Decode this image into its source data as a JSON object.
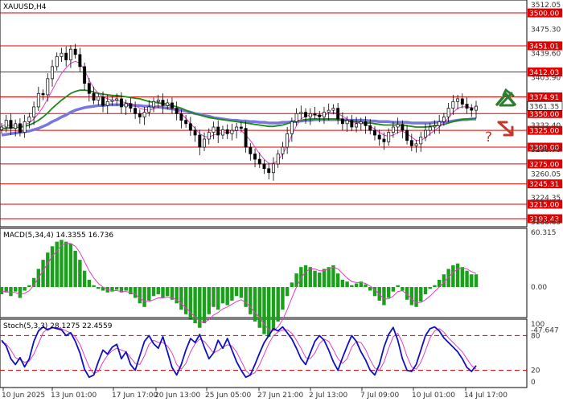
{
  "header": {
    "symbol_title": "XAUUSD,H4",
    "macd_title": "MACD(5,34,4) 14.3355 16.736",
    "stoch_title": "Stoch(5,3,3) 28.1275 22.4559"
  },
  "colors": {
    "level_line": "#e00000",
    "level_label_bg": "#e00000",
    "up_arrow": "#2e7d32",
    "down_arrow": "#c0392b",
    "question_mark": "#c0392b",
    "ma_fast": "#e040c0",
    "ma_mid": "#1a8a1a",
    "ma_slow": "#7777dd",
    "macd_bar": "#1aa01a",
    "macd_signal": "#e040c0",
    "stoch_main": "#1010c0",
    "stoch_signal": "#e040c0",
    "candle": "#000000"
  },
  "price_axis_ticks": [
    "3512.05",
    "3475.30",
    "3439.60",
    "3403.90",
    "3332.40",
    "3296.70",
    "3260.05",
    "3224.35",
    "3188.65"
  ],
  "price_levels": [
    {
      "value": 3500.0,
      "label": "3500.00"
    },
    {
      "value": 3451.01,
      "label": "3451.01"
    },
    {
      "value": 3412.03,
      "label": "3412.03"
    },
    {
      "value": 3374.91,
      "label": "3374.91"
    },
    {
      "value": 3350.0,
      "label": "3350.00"
    },
    {
      "value": 3325.0,
      "label": "3325.00"
    },
    {
      "value": 3300.0,
      "label": "3300.00"
    },
    {
      "value": 3275.0,
      "label": "3275.00"
    },
    {
      "value": 3245.31,
      "label": "3245.31"
    },
    {
      "value": 3215.0,
      "label": "3215.00"
    },
    {
      "value": 3193.43,
      "label": "3193.43"
    }
  ],
  "current_price": {
    "value": 3361.35,
    "label": "3361.35"
  },
  "macd_axis_ticks": [
    "60.315",
    "0.00",
    "-47.647"
  ],
  "stoch_axis_ticks": [
    "100",
    "80",
    "20",
    "0"
  ],
  "x_axis_labels": [
    "10 Jun 2025",
    "13 Jun 01:00",
    "17 Jun 17:00",
    "20 Jun 13:00",
    "25 Jun 05:00",
    "27 Jun 21:00",
    "2 Jul 13:00",
    "7 Jul 09:00",
    "10 Jul 01:00",
    "14 Jul 17:00"
  ],
  "annotations": {
    "question": "?"
  },
  "chart_data": {
    "type": "candlestick",
    "title": "XAUUSD,H4",
    "ylim": [
      3186,
      3514
    ],
    "price_close": [
      3330,
      3340,
      3328,
      3335,
      3322,
      3338,
      3345,
      3360,
      3380,
      3378,
      3402,
      3420,
      3435,
      3440,
      3430,
      3446,
      3438,
      3420,
      3395,
      3380,
      3370,
      3375,
      3362,
      3368,
      3370,
      3372,
      3360,
      3365,
      3358,
      3350,
      3345,
      3352,
      3360,
      3368,
      3370,
      3362,
      3366,
      3358,
      3350,
      3340,
      3335,
      3325,
      3318,
      3300,
      3312,
      3322,
      3330,
      3318,
      3326,
      3320,
      3325,
      3330,
      3328,
      3300,
      3290,
      3282,
      3275,
      3268,
      3262,
      3275,
      3290,
      3300,
      3320,
      3338,
      3350,
      3352,
      3345,
      3350,
      3348,
      3345,
      3352,
      3355,
      3358,
      3342,
      3335,
      3340,
      3330,
      3335,
      3338,
      3332,
      3325,
      3318,
      3312,
      3308,
      3322,
      3330,
      3334,
      3325,
      3310,
      3302,
      3305,
      3315,
      3325,
      3330,
      3332,
      3338,
      3345,
      3358,
      3368,
      3372,
      3364,
      3358,
      3355,
      3361
    ],
    "ma_fast": [
      3332,
      3333,
      3332,
      3333,
      3332,
      3334,
      3336,
      3342,
      3350,
      3360,
      3372,
      3385,
      3398,
      3410,
      3418,
      3425,
      3428,
      3425,
      3415,
      3400,
      3388,
      3380,
      3375,
      3372,
      3370,
      3370,
      3368,
      3366,
      3365,
      3362,
      3358,
      3356,
      3355,
      3357,
      3360,
      3362,
      3362,
      3360,
      3356,
      3350,
      3343,
      3335,
      3328,
      3320,
      3316,
      3315,
      3318,
      3320,
      3322,
      3322,
      3323,
      3325,
      3325,
      3318,
      3310,
      3300,
      3290,
      3282,
      3276,
      3276,
      3280,
      3290,
      3302,
      3318,
      3332,
      3342,
      3346,
      3348,
      3348,
      3347,
      3348,
      3350,
      3352,
      3350,
      3346,
      3342,
      3338,
      3336,
      3336,
      3334,
      3331,
      3327,
      3322,
      3318,
      3316,
      3318,
      3322,
      3324,
      3320,
      3315,
      3310,
      3310,
      3314,
      3320,
      3325,
      3330,
      3336,
      3344,
      3352,
      3358,
      3360,
      3360,
      3359,
      3358
    ],
    "ma_mid": [
      3328,
      3328,
      3329,
      3329,
      3330,
      3331,
      3333,
      3336,
      3340,
      3345,
      3351,
      3358,
      3364,
      3370,
      3375,
      3380,
      3383,
      3385,
      3385,
      3384,
      3382,
      3380,
      3379,
      3378,
      3377,
      3377,
      3376,
      3375,
      3374,
      3373,
      3372,
      3370,
      3368,
      3367,
      3366,
      3365,
      3364,
      3362,
      3360,
      3358,
      3355,
      3352,
      3350,
      3348,
      3346,
      3344,
      3343,
      3342,
      3341,
      3340,
      3339,
      3338,
      3337,
      3336,
      3335,
      3334,
      3333,
      3332,
      3331,
      3331,
      3332,
      3333,
      3335,
      3337,
      3339,
      3340,
      3341,
      3342,
      3342,
      3342,
      3342,
      3342,
      3342,
      3341,
      3340,
      3339,
      3338,
      3338,
      3337,
      3336,
      3336,
      3335,
      3334,
      3333,
      3333,
      3333,
      3333,
      3333,
      3332,
      3331,
      3330,
      3330,
      3330,
      3331,
      3332,
      3333,
      3334,
      3336,
      3338,
      3340,
      3341,
      3342,
      3342,
      3343
    ],
    "ma_slow": [
      3318,
      3319,
      3320,
      3321,
      3322,
      3323,
      3324,
      3326,
      3328,
      3331,
      3334,
      3338,
      3341,
      3345,
      3348,
      3352,
      3355,
      3357,
      3359,
      3360,
      3361,
      3362,
      3362,
      3363,
      3363,
      3363,
      3363,
      3363,
      3363,
      3362,
      3362,
      3361,
      3361,
      3360,
      3360,
      3359,
      3358,
      3357,
      3356,
      3355,
      3354,
      3352,
      3350,
      3349,
      3347,
      3346,
      3344,
      3343,
      3342,
      3341,
      3340,
      3340,
      3339,
      3339,
      3338,
      3338,
      3337,
      3337,
      3336,
      3336,
      3336,
      3337,
      3337,
      3338,
      3338,
      3339,
      3340,
      3340,
      3341,
      3341,
      3341,
      3341,
      3341,
      3341,
      3341,
      3340,
      3340,
      3340,
      3340,
      3340,
      3339,
      3339,
      3338,
      3338,
      3338,
      3337,
      3337,
      3337,
      3337,
      3336,
      3336,
      3336,
      3336,
      3336,
      3337,
      3337,
      3338,
      3338,
      3339,
      3340,
      3341,
      3341,
      3342,
      3342
    ],
    "macd": [
      -8,
      -6,
      -10,
      -5,
      -12,
      -4,
      2,
      10,
      20,
      30,
      38,
      45,
      50,
      52,
      50,
      48,
      40,
      30,
      18,
      8,
      2,
      -2,
      -4,
      -6,
      -5,
      -3,
      -6,
      -4,
      -8,
      -12,
      -18,
      -22,
      -15,
      -10,
      -8,
      -12,
      -10,
      -14,
      -18,
      -25,
      -30,
      -35,
      -40,
      -45,
      -40,
      -30,
      -22,
      -25,
      -18,
      -20,
      -15,
      -10,
      -12,
      -22,
      -30,
      -38,
      -45,
      -52,
      -55,
      -48,
      -38,
      -25,
      -10,
      5,
      15,
      22,
      24,
      22,
      18,
      16,
      20,
      22,
      24,
      15,
      8,
      6,
      2,
      4,
      6,
      3,
      -4,
      -10,
      -15,
      -20,
      -12,
      -5,
      2,
      -4,
      -14,
      -20,
      -22,
      -16,
      -8,
      -2,
      2,
      8,
      14,
      20,
      24,
      26,
      22,
      18,
      14,
      14
    ],
    "macd_signal": [
      -5,
      -5,
      -6,
      -6,
      -8,
      -7,
      -4,
      2,
      10,
      18,
      26,
      34,
      40,
      46,
      48,
      48,
      45,
      38,
      28,
      18,
      10,
      4,
      0,
      -3,
      -4,
      -4,
      -5,
      -5,
      -6,
      -8,
      -12,
      -16,
      -16,
      -14,
      -12,
      -12,
      -11,
      -12,
      -14,
      -18,
      -23,
      -28,
      -33,
      -38,
      -39,
      -36,
      -31,
      -28,
      -24,
      -22,
      -19,
      -16,
      -14,
      -17,
      -22,
      -28,
      -34,
      -41,
      -47,
      -48,
      -44,
      -36,
      -25,
      -12,
      0,
      10,
      17,
      20,
      20,
      18,
      18,
      20,
      22,
      20,
      15,
      10,
      6,
      5,
      5,
      4,
      1,
      -3,
      -8,
      -13,
      -13,
      -10,
      -5,
      -4,
      -8,
      -13,
      -17,
      -17,
      -14,
      -10,
      -5,
      0,
      5,
      11,
      16,
      20,
      21,
      20,
      17,
      15
    ],
    "stoch": [
      72,
      62,
      40,
      30,
      42,
      26,
      40,
      70,
      88,
      95,
      90,
      94,
      92,
      90,
      80,
      85,
      70,
      50,
      22,
      8,
      12,
      35,
      55,
      48,
      60,
      65,
      40,
      52,
      30,
      20,
      45,
      70,
      80,
      66,
      58,
      78,
      52,
      25,
      12,
      30,
      55,
      75,
      68,
      82,
      60,
      40,
      50,
      72,
      58,
      75,
      55,
      35,
      20,
      8,
      12,
      30,
      50,
      68,
      80,
      92,
      88,
      95,
      85,
      74,
      58,
      40,
      30,
      50,
      70,
      80,
      72,
      55,
      35,
      20,
      42,
      62,
      80,
      70,
      52,
      38,
      20,
      12,
      30,
      60,
      82,
      94,
      72,
      40,
      20,
      18,
      30,
      55,
      80,
      92,
      95,
      88,
      76,
      68,
      60,
      52,
      40,
      25,
      18,
      28
    ],
    "stoch_signal": [
      68,
      66,
      55,
      42,
      38,
      34,
      36,
      48,
      66,
      85,
      92,
      93,
      93,
      92,
      88,
      84,
      78,
      65,
      45,
      26,
      14,
      18,
      34,
      46,
      54,
      58,
      55,
      52,
      42,
      32,
      30,
      45,
      65,
      72,
      68,
      68,
      62,
      50,
      30,
      22,
      32,
      52,
      66,
      74,
      70,
      60,
      50,
      54,
      60,
      64,
      62,
      52,
      36,
      20,
      12,
      16,
      30,
      48,
      66,
      80,
      86,
      90,
      90,
      84,
      72,
      58,
      42,
      40,
      50,
      66,
      74,
      70,
      56,
      40,
      32,
      40,
      60,
      70,
      68,
      56,
      38,
      24,
      20,
      34,
      58,
      78,
      84,
      68,
      44,
      26,
      22,
      34,
      54,
      76,
      88,
      92,
      86,
      76,
      68,
      60,
      52,
      40,
      28,
      22
    ]
  }
}
